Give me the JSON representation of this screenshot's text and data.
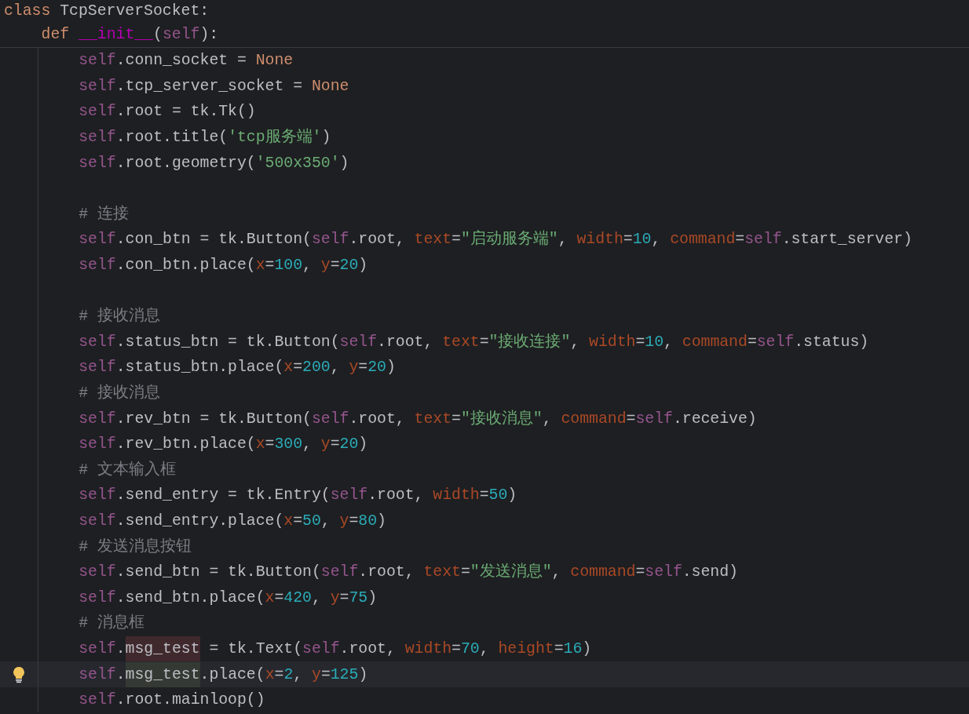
{
  "code": {
    "tokens": [
      {
        "kind": "keyword",
        "text": "class"
      },
      {
        "kind": "plain",
        "text": " TcpServerSocket:"
      }
    ],
    "children": [
      {
        "tokens": [
          {
            "kind": "keyword",
            "text": "def "
          },
          {
            "kind": "magic",
            "text": "__init__"
          },
          {
            "kind": "plain",
            "text": "("
          },
          {
            "kind": "self",
            "text": "self"
          },
          {
            "kind": "plain",
            "text": "):"
          }
        ],
        "children": [
          {
            "kind": "code",
            "current": false,
            "tokens": [
              {
                "kind": "self",
                "text": "self"
              },
              {
                "kind": "plain",
                "text": ".conn_socket = "
              },
              {
                "kind": "keyword",
                "text": "None"
              }
            ]
          },
          {
            "kind": "code",
            "current": false,
            "tokens": [
              {
                "kind": "self",
                "text": "self"
              },
              {
                "kind": "plain",
                "text": ".tcp_server_socket = "
              },
              {
                "kind": "keyword",
                "text": "None"
              }
            ]
          },
          {
            "kind": "code",
            "current": false,
            "tokens": [
              {
                "kind": "self",
                "text": "self"
              },
              {
                "kind": "plain",
                "text": ".root = tk.Tk()"
              }
            ]
          },
          {
            "kind": "code",
            "current": false,
            "tokens": [
              {
                "kind": "self",
                "text": "self"
              },
              {
                "kind": "plain",
                "text": ".root.title("
              },
              {
                "kind": "string",
                "text": "'tcp服务端'"
              },
              {
                "kind": "plain",
                "text": ")"
              }
            ]
          },
          {
            "kind": "code",
            "current": false,
            "tokens": [
              {
                "kind": "self",
                "text": "self"
              },
              {
                "kind": "plain",
                "text": ".root.geometry("
              },
              {
                "kind": "string",
                "text": "'500x350'"
              },
              {
                "kind": "plain",
                "text": ")"
              }
            ]
          },
          {
            "kind": "blank",
            "current": false
          },
          {
            "kind": "code",
            "current": false,
            "tokens": [
              {
                "kind": "comment",
                "text": "# 连接"
              }
            ]
          },
          {
            "kind": "code",
            "current": false,
            "tokens": [
              {
                "kind": "self",
                "text": "self"
              },
              {
                "kind": "plain",
                "text": ".con_btn = tk.Button("
              },
              {
                "kind": "self",
                "text": "self"
              },
              {
                "kind": "plain",
                "text": ".root, "
              },
              {
                "kind": "param",
                "text": "text"
              },
              {
                "kind": "plain",
                "text": "="
              },
              {
                "kind": "string",
                "text": "\"启动服务端\""
              },
              {
                "kind": "plain",
                "text": ", "
              },
              {
                "kind": "param",
                "text": "width"
              },
              {
                "kind": "plain",
                "text": "="
              },
              {
                "kind": "number",
                "text": "10"
              },
              {
                "kind": "plain",
                "text": ", "
              },
              {
                "kind": "param",
                "text": "command"
              },
              {
                "kind": "plain",
                "text": "="
              },
              {
                "kind": "self",
                "text": "self"
              },
              {
                "kind": "plain",
                "text": ".start_server)"
              }
            ]
          },
          {
            "kind": "code",
            "current": false,
            "tokens": [
              {
                "kind": "self",
                "text": "self"
              },
              {
                "kind": "plain",
                "text": ".con_btn.place("
              },
              {
                "kind": "param",
                "text": "x"
              },
              {
                "kind": "plain",
                "text": "="
              },
              {
                "kind": "number",
                "text": "100"
              },
              {
                "kind": "plain",
                "text": ", "
              },
              {
                "kind": "param",
                "text": "y"
              },
              {
                "kind": "plain",
                "text": "="
              },
              {
                "kind": "number",
                "text": "20"
              },
              {
                "kind": "plain",
                "text": ")"
              }
            ]
          },
          {
            "kind": "blank",
            "current": false
          },
          {
            "kind": "code",
            "current": false,
            "tokens": [
              {
                "kind": "comment",
                "text": "# 接收消息"
              }
            ]
          },
          {
            "kind": "code",
            "current": false,
            "tokens": [
              {
                "kind": "self",
                "text": "self"
              },
              {
                "kind": "plain",
                "text": ".status_btn = tk.Button("
              },
              {
                "kind": "self",
                "text": "self"
              },
              {
                "kind": "plain",
                "text": ".root, "
              },
              {
                "kind": "param",
                "text": "text"
              },
              {
                "kind": "plain",
                "text": "="
              },
              {
                "kind": "string",
                "text": "\"接收连接\""
              },
              {
                "kind": "plain",
                "text": ", "
              },
              {
                "kind": "param",
                "text": "width"
              },
              {
                "kind": "plain",
                "text": "="
              },
              {
                "kind": "number",
                "text": "10"
              },
              {
                "kind": "plain",
                "text": ", "
              },
              {
                "kind": "param",
                "text": "command"
              },
              {
                "kind": "plain",
                "text": "="
              },
              {
                "kind": "self",
                "text": "self"
              },
              {
                "kind": "plain",
                "text": ".status)"
              }
            ]
          },
          {
            "kind": "code",
            "current": false,
            "tokens": [
              {
                "kind": "self",
                "text": "self"
              },
              {
                "kind": "plain",
                "text": ".status_btn.place("
              },
              {
                "kind": "param",
                "text": "x"
              },
              {
                "kind": "plain",
                "text": "="
              },
              {
                "kind": "number",
                "text": "200"
              },
              {
                "kind": "plain",
                "text": ", "
              },
              {
                "kind": "param",
                "text": "y"
              },
              {
                "kind": "plain",
                "text": "="
              },
              {
                "kind": "number",
                "text": "20"
              },
              {
                "kind": "plain",
                "text": ")"
              }
            ]
          },
          {
            "kind": "code",
            "current": false,
            "tokens": [
              {
                "kind": "comment",
                "text": "# 接收消息"
              }
            ]
          },
          {
            "kind": "code",
            "current": false,
            "tokens": [
              {
                "kind": "self",
                "text": "self"
              },
              {
                "kind": "plain",
                "text": ".rev_btn = tk.Button("
              },
              {
                "kind": "self",
                "text": "self"
              },
              {
                "kind": "plain",
                "text": ".root, "
              },
              {
                "kind": "param",
                "text": "text"
              },
              {
                "kind": "plain",
                "text": "="
              },
              {
                "kind": "string",
                "text": "\"接收消息\""
              },
              {
                "kind": "plain",
                "text": ", "
              },
              {
                "kind": "param",
                "text": "command"
              },
              {
                "kind": "plain",
                "text": "="
              },
              {
                "kind": "self",
                "text": "self"
              },
              {
                "kind": "plain",
                "text": ".receive)"
              }
            ]
          },
          {
            "kind": "code",
            "current": false,
            "tokens": [
              {
                "kind": "self",
                "text": "self"
              },
              {
                "kind": "plain",
                "text": ".rev_btn.place("
              },
              {
                "kind": "param",
                "text": "x"
              },
              {
                "kind": "plain",
                "text": "="
              },
              {
                "kind": "number",
                "text": "300"
              },
              {
                "kind": "plain",
                "text": ", "
              },
              {
                "kind": "param",
                "text": "y"
              },
              {
                "kind": "plain",
                "text": "="
              },
              {
                "kind": "number",
                "text": "20"
              },
              {
                "kind": "plain",
                "text": ")"
              }
            ]
          },
          {
            "kind": "code",
            "current": false,
            "tokens": [
              {
                "kind": "comment",
                "text": "# 文本输入框"
              }
            ]
          },
          {
            "kind": "code",
            "current": false,
            "tokens": [
              {
                "kind": "self",
                "text": "self"
              },
              {
                "kind": "plain",
                "text": ".send_entry = tk.Entry("
              },
              {
                "kind": "self",
                "text": "self"
              },
              {
                "kind": "plain",
                "text": ".root, "
              },
              {
                "kind": "param",
                "text": "width"
              },
              {
                "kind": "plain",
                "text": "="
              },
              {
                "kind": "number",
                "text": "50"
              },
              {
                "kind": "plain",
                "text": ")"
              }
            ]
          },
          {
            "kind": "code",
            "current": false,
            "tokens": [
              {
                "kind": "self",
                "text": "self"
              },
              {
                "kind": "plain",
                "text": ".send_entry.place("
              },
              {
                "kind": "param",
                "text": "x"
              },
              {
                "kind": "plain",
                "text": "="
              },
              {
                "kind": "number",
                "text": "50"
              },
              {
                "kind": "plain",
                "text": ", "
              },
              {
                "kind": "param",
                "text": "y"
              },
              {
                "kind": "plain",
                "text": "="
              },
              {
                "kind": "number",
                "text": "80"
              },
              {
                "kind": "plain",
                "text": ")"
              }
            ]
          },
          {
            "kind": "code",
            "current": false,
            "tokens": [
              {
                "kind": "comment",
                "text": "# 发送消息按钮"
              }
            ]
          },
          {
            "kind": "code",
            "current": false,
            "tokens": [
              {
                "kind": "self",
                "text": "self"
              },
              {
                "kind": "plain",
                "text": ".send_btn = tk.Button("
              },
              {
                "kind": "self",
                "text": "self"
              },
              {
                "kind": "plain",
                "text": ".root, "
              },
              {
                "kind": "param",
                "text": "text"
              },
              {
                "kind": "plain",
                "text": "="
              },
              {
                "kind": "string",
                "text": "\"发送消息\""
              },
              {
                "kind": "plain",
                "text": ", "
              },
              {
                "kind": "param",
                "text": "command"
              },
              {
                "kind": "plain",
                "text": "="
              },
              {
                "kind": "self",
                "text": "self"
              },
              {
                "kind": "plain",
                "text": ".send)"
              }
            ]
          },
          {
            "kind": "code",
            "current": false,
            "tokens": [
              {
                "kind": "self",
                "text": "self"
              },
              {
                "kind": "plain",
                "text": ".send_btn.place("
              },
              {
                "kind": "param",
                "text": "x"
              },
              {
                "kind": "plain",
                "text": "="
              },
              {
                "kind": "number",
                "text": "420"
              },
              {
                "kind": "plain",
                "text": ", "
              },
              {
                "kind": "param",
                "text": "y"
              },
              {
                "kind": "plain",
                "text": "="
              },
              {
                "kind": "number",
                "text": "75"
              },
              {
                "kind": "plain",
                "text": ")"
              }
            ]
          },
          {
            "kind": "code",
            "current": false,
            "tokens": [
              {
                "kind": "comment",
                "text": "# 消息框"
              }
            ]
          },
          {
            "kind": "code",
            "current": false,
            "tokens": [
              {
                "kind": "self",
                "text": "self"
              },
              {
                "kind": "plain",
                "text": "."
              },
              {
                "kind": "write",
                "text": "msg_test"
              },
              {
                "kind": "plain",
                "text": " = tk.Text("
              },
              {
                "kind": "self",
                "text": "self"
              },
              {
                "kind": "plain",
                "text": ".root, "
              },
              {
                "kind": "param",
                "text": "width"
              },
              {
                "kind": "plain",
                "text": "="
              },
              {
                "kind": "number",
                "text": "70"
              },
              {
                "kind": "plain",
                "text": ", "
              },
              {
                "kind": "param",
                "text": "height"
              },
              {
                "kind": "plain",
                "text": "="
              },
              {
                "kind": "number",
                "text": "16"
              },
              {
                "kind": "plain",
                "text": ")"
              }
            ]
          },
          {
            "kind": "code",
            "current": true,
            "tokens": [
              {
                "kind": "self",
                "text": "self"
              },
              {
                "kind": "plain",
                "text": "."
              },
              {
                "kind": "read",
                "text": "msg_test"
              },
              {
                "kind": "plain",
                "text": ".place("
              },
              {
                "kind": "param",
                "text": "x"
              },
              {
                "kind": "plain",
                "text": "="
              },
              {
                "kind": "number",
                "text": "2"
              },
              {
                "kind": "plain",
                "text": ", "
              },
              {
                "kind": "param",
                "text": "y"
              },
              {
                "kind": "plain",
                "text": "="
              },
              {
                "kind": "number",
                "text": "125"
              },
              {
                "kind": "plain",
                "text": ")"
              }
            ]
          },
          {
            "kind": "code",
            "current": false,
            "tokens": [
              {
                "kind": "self",
                "text": "self"
              },
              {
                "kind": "plain",
                "text": ".root.mainloop()"
              }
            ]
          }
        ]
      }
    ]
  }
}
